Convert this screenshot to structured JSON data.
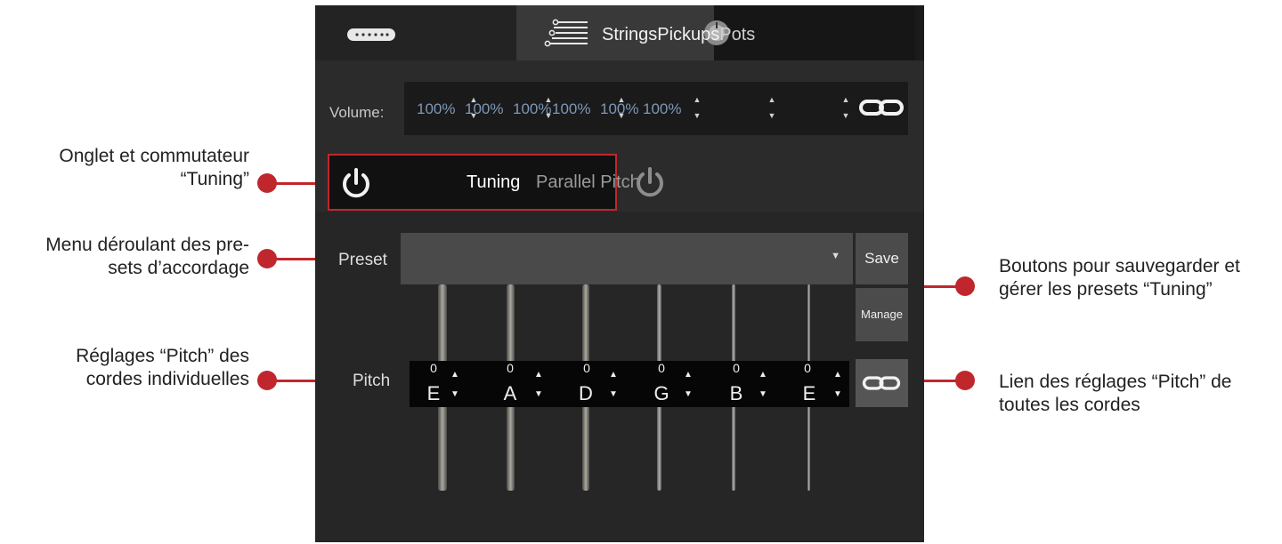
{
  "tabs": [
    {
      "label": "Strings"
    },
    {
      "label": "Pickups"
    },
    {
      "label": "Pots"
    }
  ],
  "volume": {
    "label": "Volume:",
    "values": [
      "100%",
      "100%",
      "100%",
      "100%",
      "100%",
      "100%"
    ]
  },
  "subtabs": {
    "tuning": "Tuning",
    "parallel_pitch": "Parallel Pitch"
  },
  "preset": {
    "label": "Preset",
    "value": "",
    "save_label": "Save",
    "manage_label": "Manage"
  },
  "pitch": {
    "label": "Pitch",
    "strings": [
      {
        "value": "0",
        "note": "E"
      },
      {
        "value": "0",
        "note": "A"
      },
      {
        "value": "0",
        "note": "D"
      },
      {
        "value": "0",
        "note": "G"
      },
      {
        "value": "0",
        "note": "B"
      },
      {
        "value": "0",
        "note": "E"
      }
    ]
  },
  "annotations": {
    "tuning_tab": [
      "Onglet et commutateur",
      "“Tuning”"
    ],
    "preset_menu": [
      "Menu déroulant des pre-",
      "sets d’accordage"
    ],
    "pitch_settings": [
      "Réglages “Pitch” des",
      "cordes individuelles"
    ],
    "preset_buttons": [
      "Boutons pour sauvegarder et",
      "gérer les presets “Tuning”"
    ],
    "pitch_link": [
      "Lien des réglages “Pitch” de",
      "toutes les cordes"
    ]
  },
  "icons": {
    "pickup": "pickup-icon",
    "strings": "strings-icon",
    "knob": "knob-icon",
    "power": "power-icon",
    "link": "chain-link-icon"
  },
  "colors": {
    "accent": "#c0272d",
    "panel": "#2b2b2b",
    "volume_text": "#7e98b8"
  }
}
